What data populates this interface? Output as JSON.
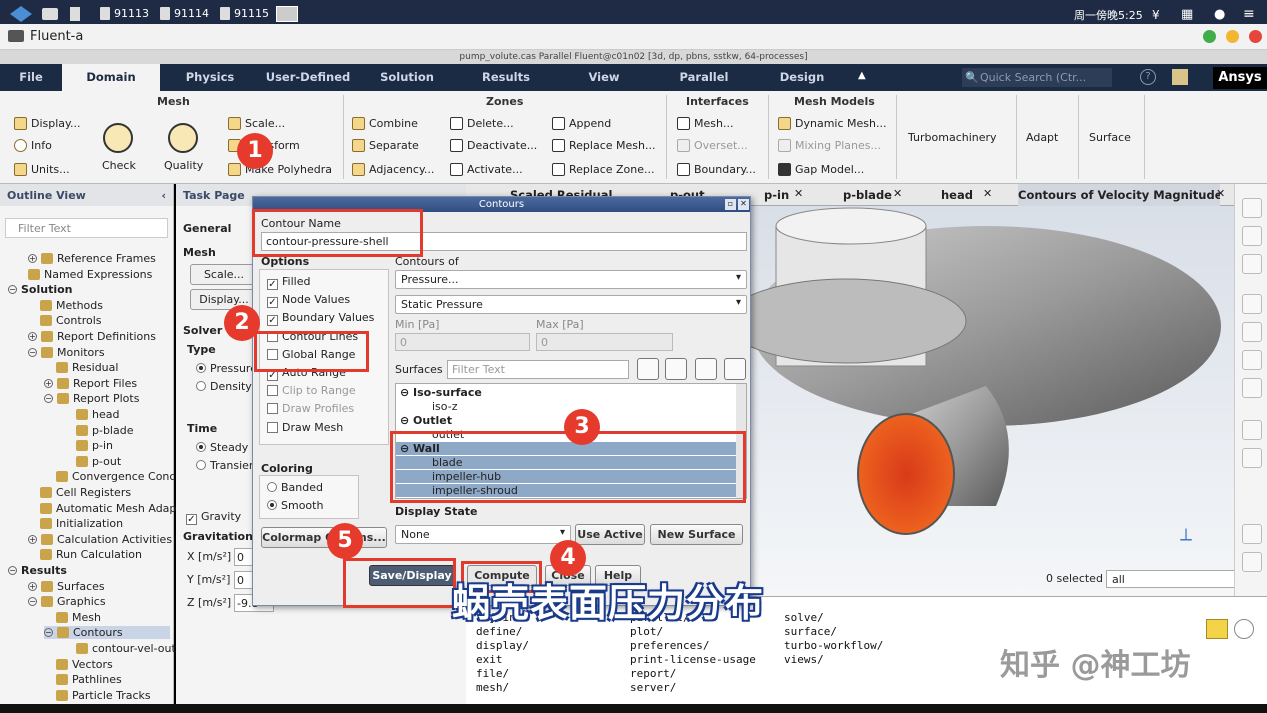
{
  "taskbar": {
    "items": [
      "91113",
      "91114",
      "91115"
    ],
    "clock": "周一傍晚5:25"
  },
  "app": {
    "title": "Fluent-a",
    "caption": "pump_volute.cas Parallel Fluent@c01n02  [3d, dp, pbns, sstkw, 64-processes]"
  },
  "ribbon_tabs": [
    "File",
    "Domain",
    "Physics",
    "User-Defined",
    "Solution",
    "Results",
    "View",
    "Parallel",
    "Design"
  ],
  "active_tab": "Domain",
  "quick_search_placeholder": "Quick Search (Ctr...",
  "brand": "Ansys",
  "ribbon": {
    "mesh_group": "Mesh",
    "mesh_items": [
      "Display...",
      "Info",
      "Units...",
      "Check",
      "Quality",
      "Scale...",
      "Transform",
      "Make Polyhedra"
    ],
    "zones_group": "Zones",
    "zones_items": [
      "Combine",
      "Separate",
      "Adjacency...",
      "Delete...",
      "Deactivate...",
      "Activate...",
      "Append",
      "Replace Mesh...",
      "Replace Zone..."
    ],
    "interfaces_group": "Interfaces",
    "interfaces_items": [
      "Mesh...",
      "Overset...",
      "Boundary..."
    ],
    "mesh_models_group": "Mesh Models",
    "mesh_models_items": [
      "Dynamic Mesh...",
      "Mixing Planes...",
      "Gap Model..."
    ],
    "extra_groups": [
      "Turbomachinery",
      "Adapt",
      "Surface"
    ]
  },
  "outline": {
    "header": "Outline View",
    "filter_placeholder": "Filter Text",
    "items": [
      {
        "label": "Reference Frames",
        "bold": false
      },
      {
        "label": "Named Expressions",
        "bold": false
      },
      {
        "label": "Solution",
        "bold": true
      },
      {
        "label": "Methods",
        "bold": false
      },
      {
        "label": "Controls",
        "bold": false
      },
      {
        "label": "Report Definitions",
        "bold": false
      },
      {
        "label": "Monitors",
        "bold": false
      },
      {
        "label": "Residual",
        "bold": false
      },
      {
        "label": "Report Files",
        "bold": false
      },
      {
        "label": "Report Plots",
        "bold": false
      },
      {
        "label": "head",
        "bold": false
      },
      {
        "label": "p-blade",
        "bold": false
      },
      {
        "label": "p-in",
        "bold": false
      },
      {
        "label": "p-out",
        "bold": false
      },
      {
        "label": "Convergence Conc",
        "bold": false
      },
      {
        "label": "Cell Registers",
        "bold": false
      },
      {
        "label": "Automatic Mesh Adap",
        "bold": false
      },
      {
        "label": "Initialization",
        "bold": false
      },
      {
        "label": "Calculation Activities",
        "bold": false
      },
      {
        "label": "Run Calculation",
        "bold": false
      },
      {
        "label": "Results",
        "bold": true
      },
      {
        "label": "Surfaces",
        "bold": false
      },
      {
        "label": "Graphics",
        "bold": false
      },
      {
        "label": "Mesh",
        "bold": false
      },
      {
        "label": "Contours",
        "bold": false
      },
      {
        "label": "contour-vel-out",
        "bold": false
      },
      {
        "label": "Vectors",
        "bold": false
      },
      {
        "label": "Pathlines",
        "bold": false
      },
      {
        "label": "Particle Tracks",
        "bold": false
      }
    ]
  },
  "task_page": {
    "header": "Task Page",
    "general": "General",
    "mesh": "Mesh",
    "scale_btn": "Scale...",
    "display_btn": "Display...",
    "solver": "Solver",
    "type": "Type",
    "pressure": "Pressure",
    "density": "Density-",
    "time": "Time",
    "steady": "Steady",
    "transient": "Transien",
    "gravity": "Gravity",
    "gravitational": "Gravitationa",
    "x_label": "X [m/s²]",
    "y_label": "Y [m/s²]",
    "z_label": "Z [m/s²]",
    "x_val": "0",
    "y_val": "0",
    "z_val": "-9.8"
  },
  "graphics_tabs": [
    "Scaled Residual",
    "p-out",
    "p-in",
    "p-blade",
    "head",
    "Contours of Velocity Magnitude [m"
  ],
  "graphics": {
    "selected_label": "0 selected",
    "selected_filter": "all"
  },
  "dialog": {
    "title": "Contours",
    "contour_name_label": "Contour Name",
    "contour_name": "contour-pressure-shell",
    "options_label": "Options",
    "options": [
      {
        "label": "Filled",
        "checked": true
      },
      {
        "label": "Node Values",
        "checked": true
      },
      {
        "label": "Boundary Values",
        "checked": true
      },
      {
        "label": "Contour Lines",
        "checked": false
      },
      {
        "label": "Global Range",
        "checked": false
      },
      {
        "label": "Auto Range",
        "checked": true
      },
      {
        "label": "Clip to Range",
        "checked": false
      },
      {
        "label": "Draw Profiles",
        "checked": false
      },
      {
        "label": "Draw Mesh",
        "checked": false
      }
    ],
    "coloring_label": "Coloring",
    "banded": "Banded",
    "smooth": "Smooth",
    "colormap_btn": "Colormap Options...",
    "contours_of_label": "Contours of",
    "contours_of": "Pressure...",
    "contours_sub": "Static Pressure",
    "min_label": "Min [Pa]",
    "max_label": "Max [Pa]",
    "min_val": "0",
    "max_val": "0",
    "surfaces_label": "Surfaces",
    "surfaces_filter": "Filter Text",
    "surface_groups": [
      {
        "group": "Iso-surface",
        "items": [
          "iso-z"
        ]
      },
      {
        "group": "Outlet",
        "items": [
          "outlet"
        ]
      },
      {
        "group": "Wall",
        "items": [
          "blade",
          "impeller-hub",
          "impeller-shroud"
        ]
      }
    ],
    "display_state_label": "Display State",
    "display_state": "None",
    "use_active": "Use Active",
    "new_surface": "New Surface",
    "save_display": "Save/Display",
    "compute": "Compute",
    "close": "Close",
    "help": "Help"
  },
  "console": {
    "col1": [
      "adjoint/",
      "define/",
      "display/",
      "exit",
      "file/",
      "mesh/"
    ],
    "col2": [
      "parallel/",
      "plot/",
      "preferences/",
      "print-license-usage",
      "report/",
      "server/"
    ],
    "col3": [
      "solve/",
      "surface/",
      "turbo-workflow/",
      "views/"
    ]
  },
  "badges": [
    "1",
    "2",
    "3",
    "4",
    "5"
  ],
  "subtitle": "蜗壳表面压力分布",
  "watermark": "知乎 @神工坊",
  "colors": {
    "ribbon_dark": "#1b2b44",
    "highlight_red": "#e23b2e",
    "selection_blue": "#8ea8c8"
  }
}
